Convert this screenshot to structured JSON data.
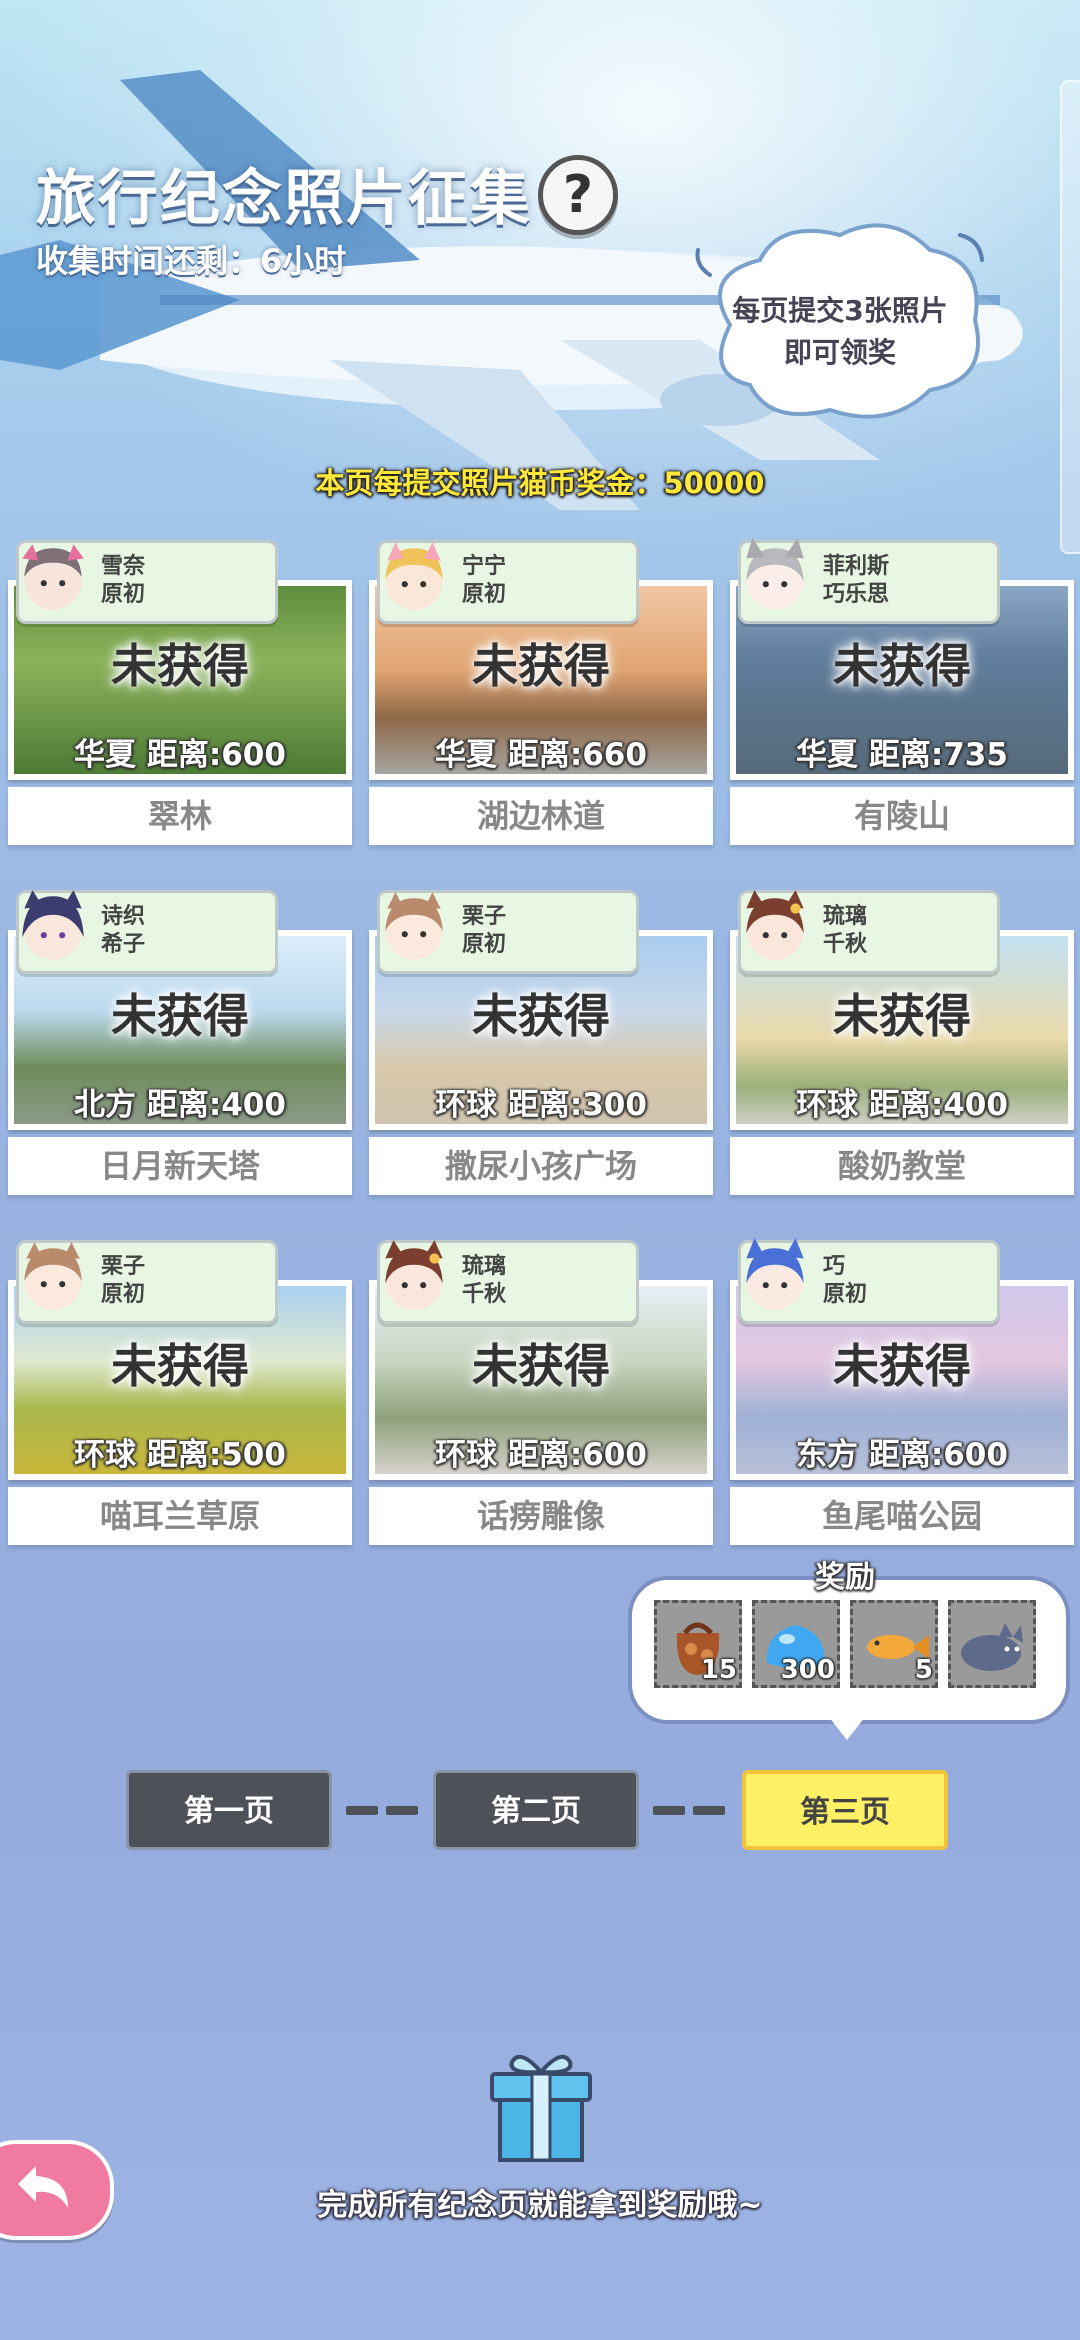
{
  "header": {
    "title": "旅行纪念照片征集",
    "help_symbol": "?",
    "timer": "收集时间还剩：6小时",
    "bubble_line1": "每页提交3张照片",
    "bubble_line2": "即可领奖",
    "bonus": "本页每提交照片猫币奖金：50000"
  },
  "cards": [
    {
      "char1": "雪奈",
      "char2": "原初",
      "status": "未获得",
      "dist": "华夏  距离:600",
      "name": "翠林"
    },
    {
      "char1": "宁宁",
      "char2": "原初",
      "status": "未获得",
      "dist": "华夏  距离:660",
      "name": "湖边林道"
    },
    {
      "char1": "菲利斯",
      "char2": "巧乐思",
      "status": "未获得",
      "dist": "华夏  距离:735",
      "name": "有陵山"
    },
    {
      "char1": "诗织",
      "char2": "希子",
      "status": "未获得",
      "dist": "北方  距离:400",
      "name": "日月新天塔"
    },
    {
      "char1": "栗子",
      "char2": "原初",
      "status": "未获得",
      "dist": "环球  距离:300",
      "name": "撒尿小孩广场"
    },
    {
      "char1": "琉璃",
      "char2": "千秋",
      "status": "未获得",
      "dist": "环球  距离:400",
      "name": "酸奶教堂"
    },
    {
      "char1": "栗子",
      "char2": "原初",
      "status": "未获得",
      "dist": "环球  距离:500",
      "name": "喵耳兰草原"
    },
    {
      "char1": "琉璃",
      "char2": "千秋",
      "status": "未获得",
      "dist": "环球  距离:600",
      "name": "话痨雕像"
    },
    {
      "char1": "巧",
      "char2": "原初",
      "status": "未获得",
      "dist": "东方  距离:600",
      "name": "鱼尾喵公园"
    }
  ],
  "rewards": {
    "label": "奖励",
    "items": [
      {
        "icon": "gift-bag-icon",
        "count": "15"
      },
      {
        "icon": "blue-slime-icon",
        "count": "300"
      },
      {
        "icon": "fish-icon",
        "count": "5"
      },
      {
        "icon": "cat-plush-icon",
        "count": ""
      }
    ]
  },
  "pages": [
    {
      "label": "第一页",
      "active": false
    },
    {
      "label": "第二页",
      "active": false
    },
    {
      "label": "第三页",
      "active": true
    }
  ],
  "footer": {
    "text": "完成所有纪念页就能拿到奖励哦~"
  },
  "colors": {
    "accent_yellow": "#fff066",
    "tag_green": "#e7f7e3",
    "back_pink": "#f07aa0"
  }
}
